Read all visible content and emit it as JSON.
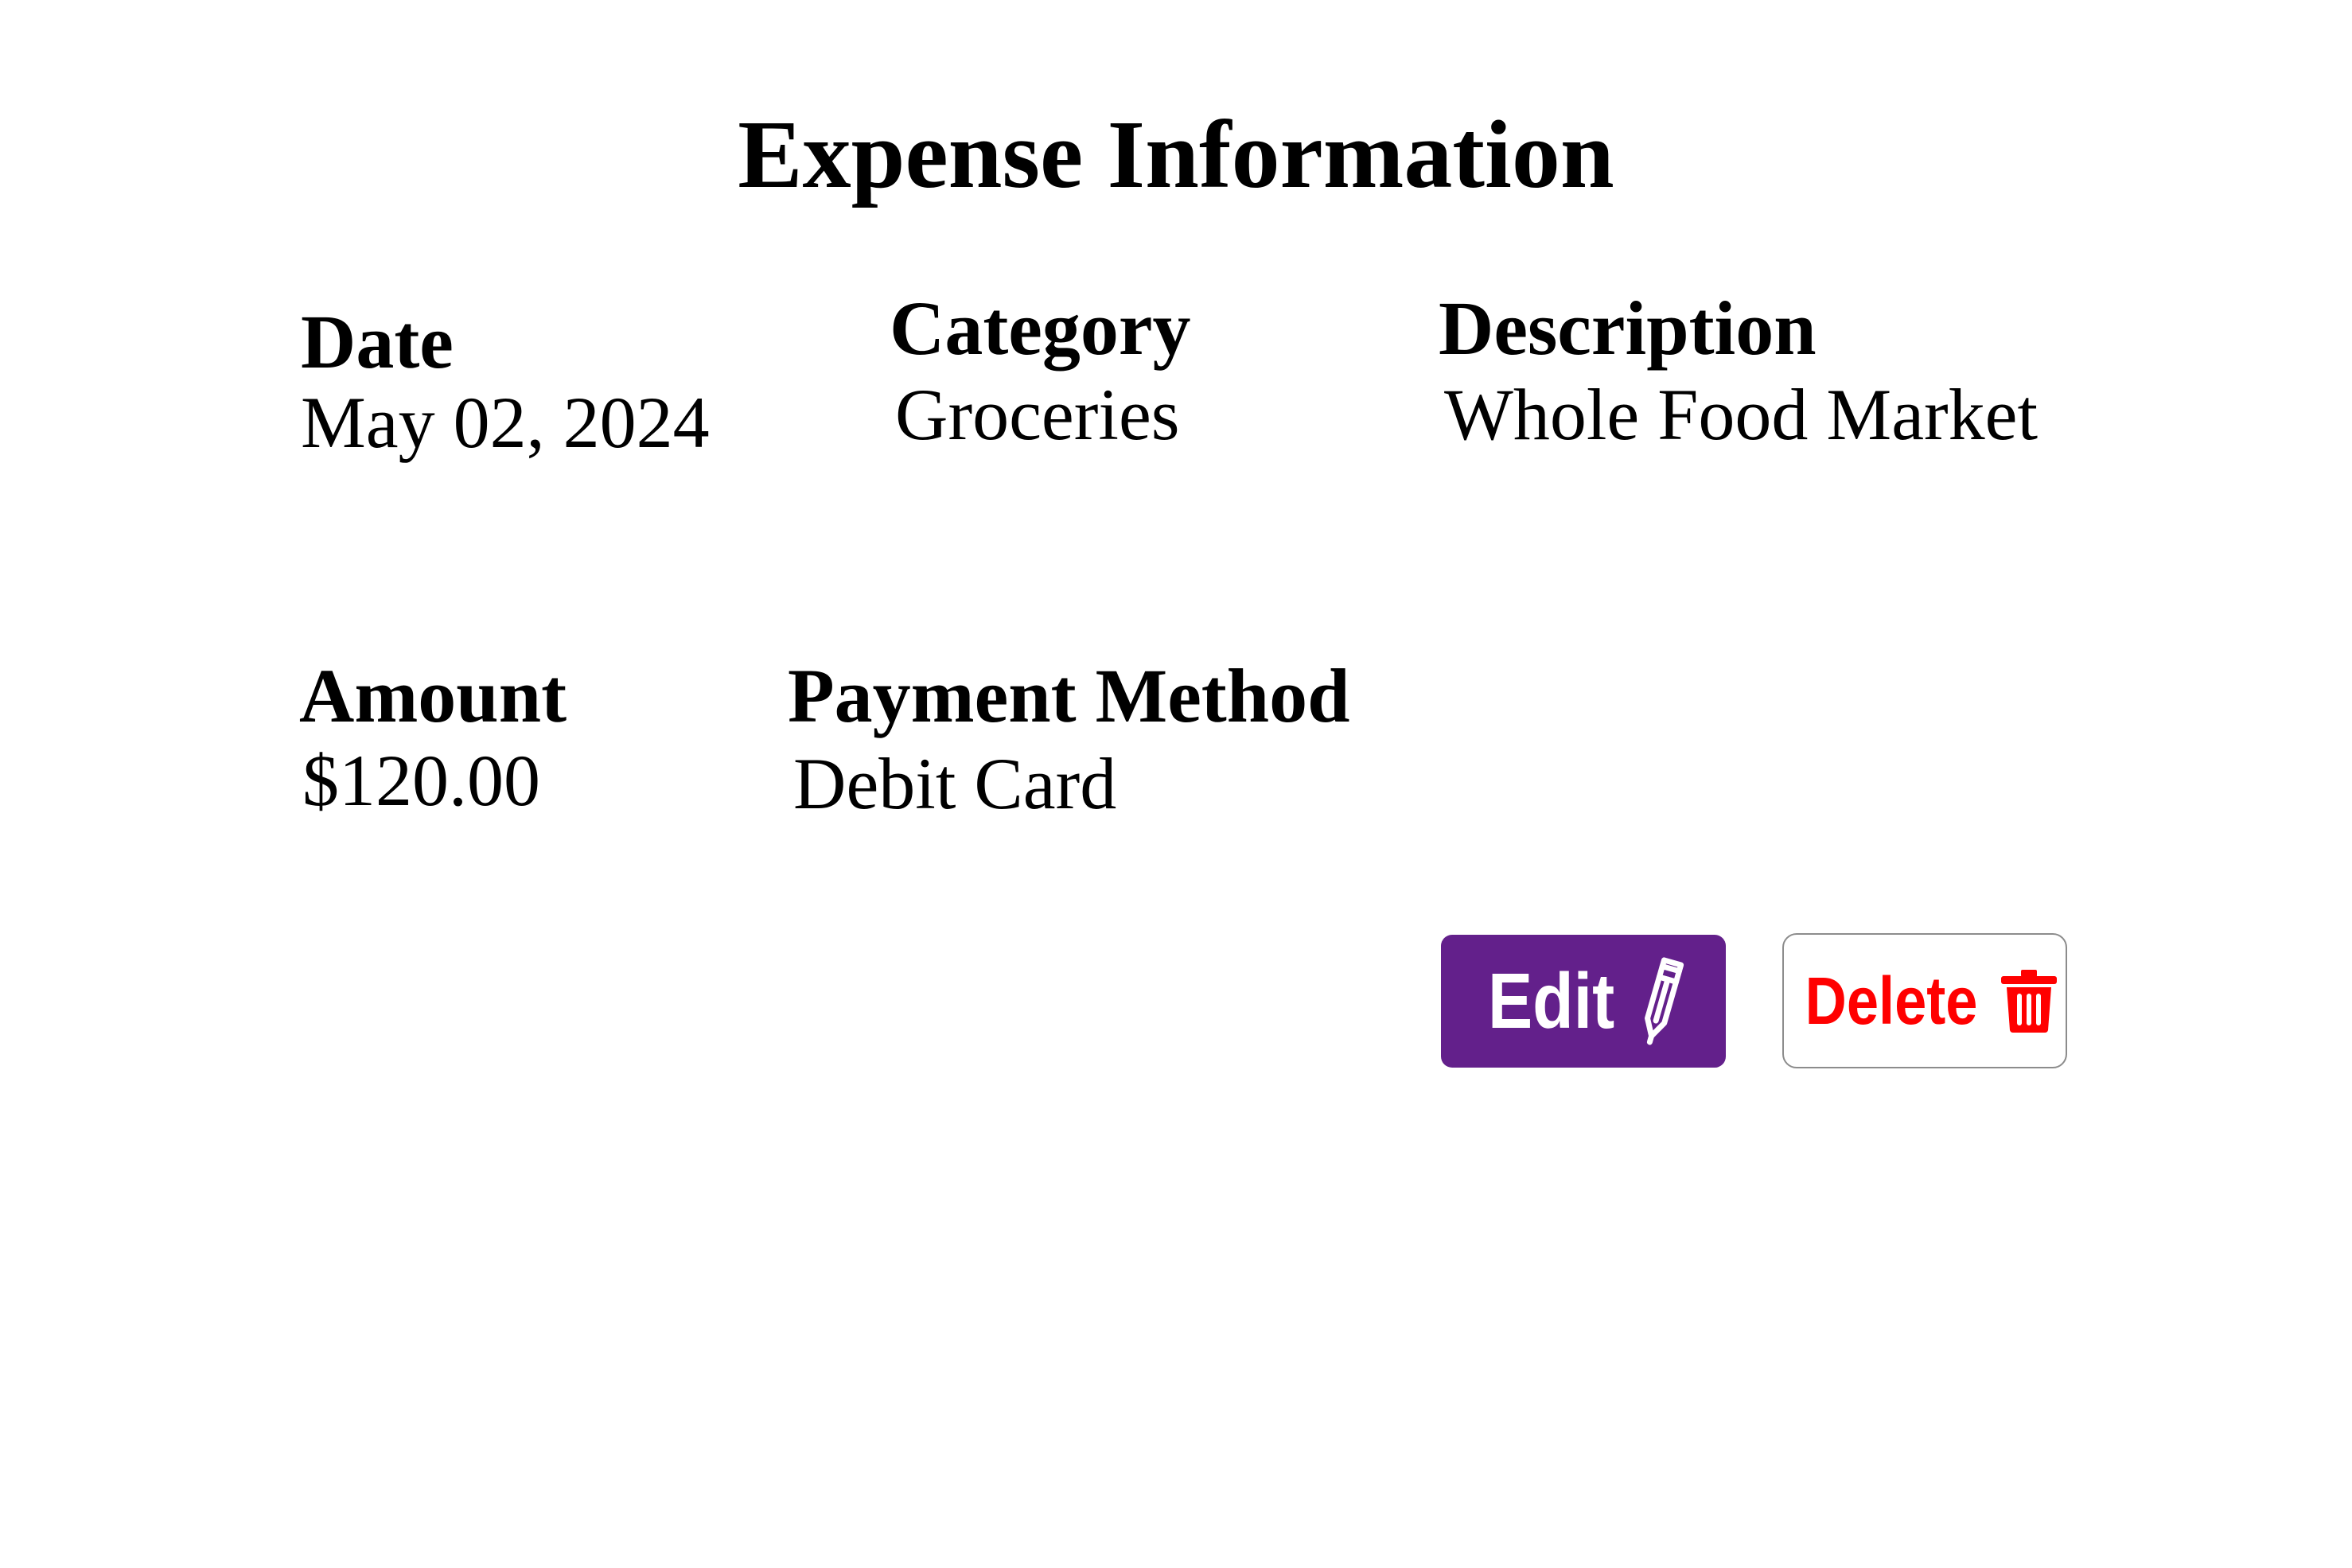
{
  "page": {
    "title": "Expense Information"
  },
  "fields": {
    "date": {
      "label": "Date",
      "value": "May 02, 2024"
    },
    "category": {
      "label": "Category",
      "value": "Groceries"
    },
    "description": {
      "label": "Description",
      "value": "Whole Food Market"
    },
    "amount": {
      "label": "Amount",
      "value": "$120.00"
    },
    "payment_method": {
      "label": "Payment Method",
      "value": "Debit Card"
    }
  },
  "actions": {
    "edit": {
      "label": "Edit",
      "icon": "pencil-icon",
      "color": "#63208b"
    },
    "delete": {
      "label": "Delete",
      "icon": "trash-icon",
      "color": "#ff0000"
    }
  }
}
